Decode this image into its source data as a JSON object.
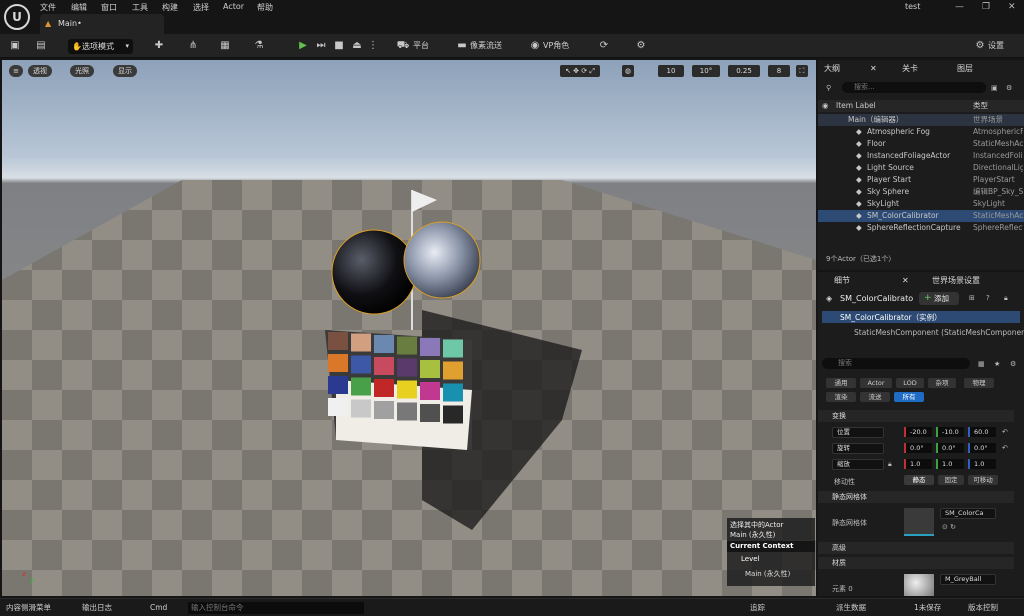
{
  "menubar": {
    "items": [
      "文件",
      "编辑",
      "窗口",
      "工具",
      "构建",
      "选择",
      "Actor",
      "帮助"
    ],
    "project": "test",
    "tab_label": "Main•"
  },
  "toolbar": {
    "mode_label": "选项模式",
    "platform_label": "平台",
    "pixel_stream_label": "像素流送",
    "vp_label": "VP角色",
    "settings_label": "设置"
  },
  "viewport": {
    "perspective_label": "透视",
    "lit_label": "光照",
    "show_label": "显示",
    "grid_value": "10",
    "rotation_value": "10°",
    "scale_value": "0.25",
    "camera_speed": "8",
    "selection_info_line1": "选择其中的Actor",
    "selection_info_line2": "Main (永久性)",
    "context_header": "Current Context",
    "context_level": "Level",
    "context_value": "Main (永久性)",
    "swatch_colors": [
      "#7a5040",
      "#d2a080",
      "#6a88b0",
      "#6a7d40",
      "#8a78b8",
      "#6ec8a8",
      "#d87828",
      "#3e58a8",
      "#c84a5e",
      "#5a3a6a",
      "#a8c040",
      "#e0a030",
      "#2a3a90",
      "#48a048",
      "#c02828",
      "#e8d020",
      "#c03890",
      "#1890b0",
      "#f0f0f0",
      "#c8c8c8",
      "#a0a0a0",
      "#787878",
      "#505050",
      "#282828"
    ]
  },
  "outliner": {
    "tab_outline": "大纲",
    "tab_level": "关卡",
    "tab_layers": "图层",
    "search_placeholder": "搜索...",
    "col_label": "Item Label",
    "col_type": "类型",
    "root": {
      "name": "Main（编辑器）",
      "type": "世界场景"
    },
    "items": [
      {
        "name": "Atmospheric Fog",
        "type": "AtmosphericF",
        "icon": "fog-icon"
      },
      {
        "name": "Floor",
        "type": "StaticMeshAc",
        "icon": "cube-icon"
      },
      {
        "name": "InstancedFoliageActor",
        "type": "InstancedFolia",
        "icon": "foliage-icon"
      },
      {
        "name": "Light Source",
        "type": "DirectionalLig",
        "icon": "light-icon"
      },
      {
        "name": "Player Start",
        "type": "PlayerStart",
        "icon": "player-start-icon"
      },
      {
        "name": "Sky Sphere",
        "type": "编辑BP_Sky_S",
        "icon": "sphere-icon"
      },
      {
        "name": "SkyLight",
        "type": "SkyLight",
        "icon": "skylight-icon"
      },
      {
        "name": "SM_ColorCalibrator",
        "type": "StaticMeshAc",
        "icon": "cube-icon"
      },
      {
        "name": "SphereReflectionCapture",
        "type": "SphereReflect",
        "icon": "reflection-icon"
      }
    ],
    "summary": "9个Actor（已选1个）"
  },
  "details": {
    "tab_details": "细节",
    "tab_world": "世界场景设置",
    "object_name": "SM_ColorCalibrato",
    "add_label": "添加",
    "instance_label": "SM_ColorCalibrator（实例）",
    "component_label": "StaticMeshComponent (StaticMeshComponer",
    "search_placeholder": "搜索",
    "categories_row1": [
      "通用",
      "Actor",
      "LOD",
      "杂项",
      "物理"
    ],
    "categories_row2": [
      "渲染",
      "流送",
      "所有"
    ],
    "transform_section": "变换",
    "location_label": "位置",
    "rotation_label": "旋转",
    "scale_label": "缩放",
    "location": [
      "-20.0",
      "-10.0",
      "60.0"
    ],
    "rotation": [
      "0.0°",
      "0.0°",
      "0.0°"
    ],
    "scale": [
      "1.0",
      "1.0",
      "1.0"
    ],
    "mobility_label": "移动性",
    "mobility_options": [
      "静态",
      "固定",
      "可移动"
    ],
    "static_mesh_section": "静态网格体",
    "static_mesh_label": "静态网格体",
    "static_mesh_value": "SM_ColorCa",
    "advanced_section": "高级",
    "materials_section": "材质",
    "element_label": "元素 0",
    "material_value": "M_GreyBall"
  },
  "statusbar": {
    "content_drawer": "内容侧滑菜单",
    "output_log": "输出日志",
    "cmd_label": "Cmd",
    "cmd_placeholder": "输入控制台命令",
    "trace_label": "追踪",
    "derived_data": "派生数据",
    "unsaved": "1未保存",
    "source_control": "版本控制"
  }
}
